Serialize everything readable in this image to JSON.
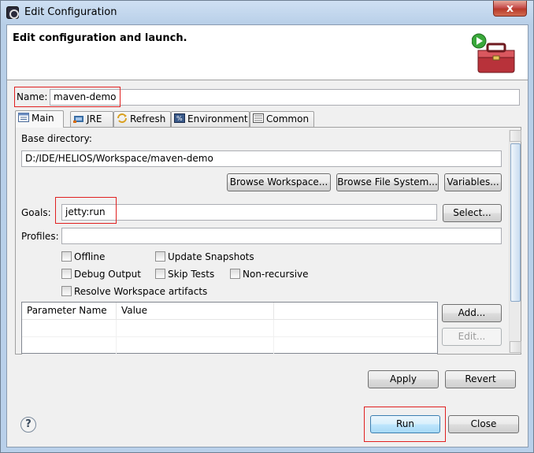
{
  "window": {
    "title": "Edit Configuration",
    "close_glyph": "x"
  },
  "header": {
    "title": "Edit configuration and launch.",
    "icon": "toolbox-run-icon"
  },
  "name_field": {
    "label": "Name:",
    "value": "maven-demo"
  },
  "tabs": [
    {
      "label": "Main",
      "icon": "main-tab-icon",
      "active": true
    },
    {
      "label": "JRE",
      "icon": "jre-icon",
      "active": false
    },
    {
      "label": "Refresh",
      "icon": "refresh-icon",
      "active": false
    },
    {
      "label": "Environment",
      "icon": "environment-icon",
      "active": false
    },
    {
      "label": "Common",
      "icon": "common-icon",
      "active": false
    }
  ],
  "main": {
    "base_directory_label": "Base directory:",
    "base_directory_value": "D:/IDE/HELIOS/Workspace/maven-demo",
    "browse_workspace": "Browse Workspace...",
    "browse_file_system": "Browse File System...",
    "variables": "Variables...",
    "goals_label": "Goals:",
    "goals_value": "jetty:run",
    "select": "Select...",
    "profiles_label": "Profiles:",
    "profiles_value": "",
    "checkboxes": {
      "offline": "Offline",
      "update_snapshots": "Update Snapshots",
      "debug_output": "Debug Output",
      "skip_tests": "Skip Tests",
      "non_recursive": "Non-recursive",
      "resolve_workspace": "Resolve Workspace artifacts"
    },
    "table": {
      "columns": [
        "Parameter Name",
        "Value",
        ""
      ]
    },
    "add": "Add...",
    "edit": "Edit..."
  },
  "actions": {
    "apply": "Apply",
    "revert": "Revert",
    "run": "Run",
    "close": "Close",
    "help": "?"
  },
  "colors": {
    "highlight": "#e02020",
    "default_button": "#3c7fb1"
  }
}
